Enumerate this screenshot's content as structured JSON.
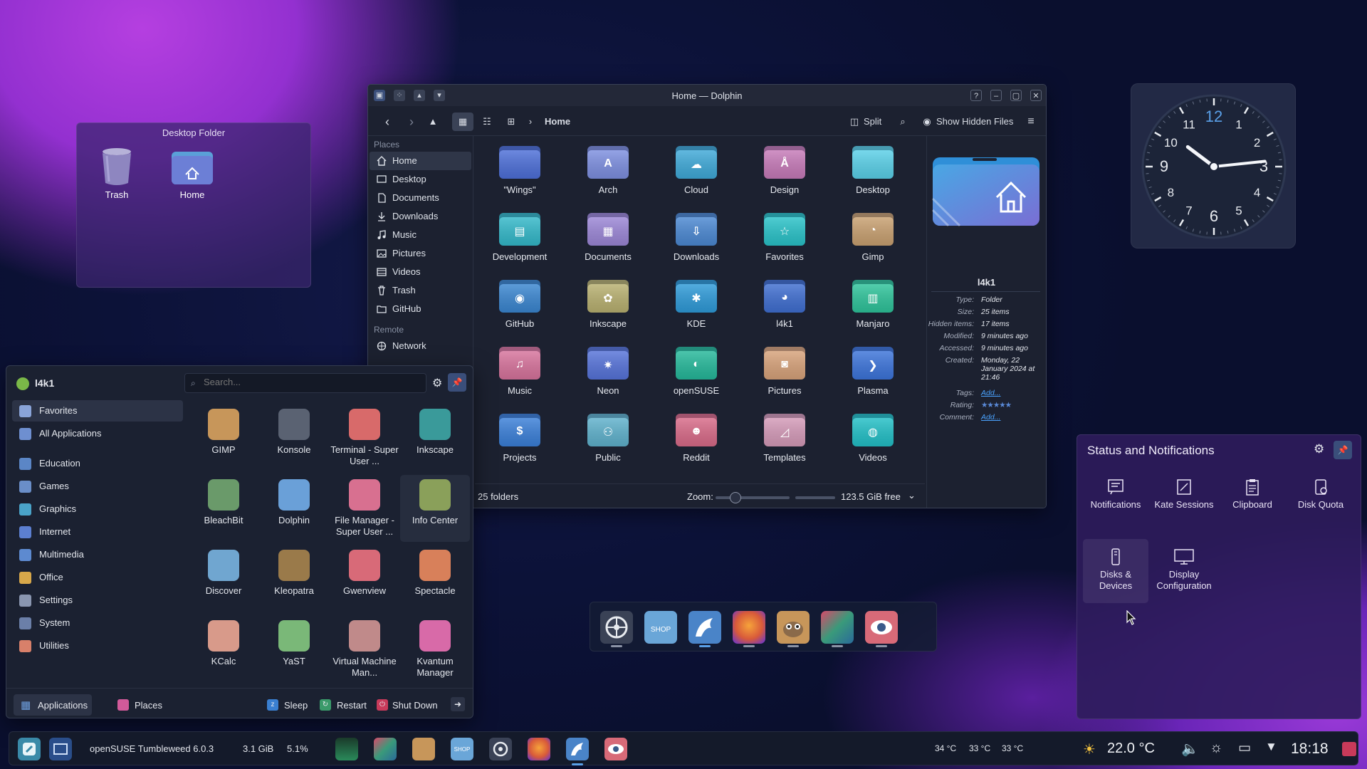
{
  "desktop_folder": {
    "title": "Desktop Folder",
    "items": [
      {
        "label": "Trash"
      },
      {
        "label": "Home"
      }
    ]
  },
  "dolphin": {
    "title": "Home — Dolphin",
    "breadcrumb": "Home",
    "toolbar": {
      "split": "Split",
      "show_hidden": "Show Hidden Files"
    },
    "places_header": "Places",
    "places": [
      {
        "label": "Home",
        "icon": "home-icon"
      },
      {
        "label": "Desktop",
        "icon": "desktop-icon"
      },
      {
        "label": "Documents",
        "icon": "documents-icon"
      },
      {
        "label": "Downloads",
        "icon": "downloads-icon"
      },
      {
        "label": "Music",
        "icon": "music-icon"
      },
      {
        "label": "Pictures",
        "icon": "pictures-icon"
      },
      {
        "label": "Videos",
        "icon": "videos-icon"
      },
      {
        "label": "Trash",
        "icon": "trash-icon"
      },
      {
        "label": "GitHub",
        "icon": "folder-icon"
      }
    ],
    "remote_header": "Remote",
    "remote": [
      {
        "label": "Network",
        "icon": "network-icon"
      }
    ],
    "folders": [
      {
        "label": "\"Wings\"",
        "color": "#4d6fd8",
        "glyph": ""
      },
      {
        "label": "Arch",
        "color": "#7d8fe0",
        "glyph": "A"
      },
      {
        "label": "Cloud",
        "color": "#3fa9d8",
        "glyph": "☁"
      },
      {
        "label": "Design",
        "color": "#c67ab8",
        "glyph": "Å"
      },
      {
        "label": "Desktop",
        "color": "#5ad0e8",
        "glyph": ""
      },
      {
        "label": "Development",
        "color": "#33b8c9",
        "glyph": "▤"
      },
      {
        "label": "Documents",
        "color": "#9b86d6",
        "glyph": "▦"
      },
      {
        "label": "Downloads",
        "color": "#4b88d2",
        "glyph": "⇩"
      },
      {
        "label": "Favorites",
        "color": "#29c2c8",
        "glyph": "☆"
      },
      {
        "label": "Gimp",
        "color": "#c8a070",
        "glyph": "◔"
      },
      {
        "label": "GitHub",
        "color": "#3a86d0",
        "glyph": "◉"
      },
      {
        "label": "Inkscape",
        "color": "#b8b070",
        "glyph": "✿"
      },
      {
        "label": "KDE",
        "color": "#2e9ad8",
        "glyph": "✱"
      },
      {
        "label": "l4k1",
        "color": "#3f6ed0",
        "glyph": "◕"
      },
      {
        "label": "Manjaro",
        "color": "#2ec39a",
        "glyph": "▥"
      },
      {
        "label": "Music",
        "color": "#d7739c",
        "glyph": "♫"
      },
      {
        "label": "Neon",
        "color": "#5673d9",
        "glyph": "✷"
      },
      {
        "label": "openSUSE",
        "color": "#25b89a",
        "glyph": "◐"
      },
      {
        "label": "Pictures",
        "color": "#d7a27a",
        "glyph": "◙"
      },
      {
        "label": "Plasma",
        "color": "#3c74da",
        "glyph": "❯"
      },
      {
        "label": "Projects",
        "color": "#3a7fd8",
        "glyph": "$"
      },
      {
        "label": "Public",
        "color": "#5fb1cc",
        "glyph": "⚇"
      },
      {
        "label": "Reddit",
        "color": "#d86a88",
        "glyph": "☻"
      },
      {
        "label": "Templates",
        "color": "#d49ab8",
        "glyph": "◿"
      },
      {
        "label": "Videos",
        "color": "#22bfc6",
        "glyph": "◍"
      }
    ],
    "info": {
      "name": "l4k1",
      "rows": [
        {
          "k": "Type:",
          "v": "Folder"
        },
        {
          "k": "Size:",
          "v": "25 items"
        },
        {
          "k": "Hidden items:",
          "v": "17 items"
        },
        {
          "k": "Modified:",
          "v": "9 minutes ago"
        },
        {
          "k": "Accessed:",
          "v": "9 minutes ago"
        },
        {
          "k": "Created:",
          "v": "Monday, 22 January 2024 at 21:46"
        }
      ],
      "tags_label": "Tags:",
      "tags_value": "Add...",
      "rating_label": "Rating:",
      "comment_label": "Comment:",
      "comment_value": "Add..."
    },
    "status": {
      "count": "25 folders",
      "zoom_label": "Zoom:",
      "free": "123.5 GiB free"
    }
  },
  "clock": {
    "hours": "10",
    "minutes": "14"
  },
  "app_menu": {
    "user": "l4k1",
    "search_placeholder": "Search...",
    "categories": [
      {
        "label": "Favorites",
        "color": "#8aa4d8"
      },
      {
        "label": "All Applications",
        "color": "#6e8fd0"
      },
      {
        "label": "Education",
        "color": "#5b86c6"
      },
      {
        "label": "Games",
        "color": "#6a8ec8"
      },
      {
        "label": "Graphics",
        "color": "#4aa3c8"
      },
      {
        "label": "Internet",
        "color": "#5c7fd0"
      },
      {
        "label": "Multimedia",
        "color": "#5d8ad0"
      },
      {
        "label": "Office",
        "color": "#d8a84a"
      },
      {
        "label": "Settings",
        "color": "#8a96b0"
      },
      {
        "label": "System",
        "color": "#6b7fa8"
      },
      {
        "label": "Utilities",
        "color": "#d8806a"
      }
    ],
    "apps": [
      {
        "label": "GIMP",
        "color": "#c7965a"
      },
      {
        "label": "Konsole",
        "color": "#5a6272"
      },
      {
        "label": "Terminal - Super User ...",
        "color": "#d86a6a"
      },
      {
        "label": "Inkscape",
        "color": "#3a9a9a"
      },
      {
        "label": "BleachBit",
        "color": "#6a9a6a"
      },
      {
        "label": "Dolphin",
        "color": "#6aa0d8"
      },
      {
        "label": "File Manager - Super User ...",
        "color": "#d87090"
      },
      {
        "label": "Info Center",
        "color": "#8aa05a"
      },
      {
        "label": "Discover",
        "color": "#70a6d0"
      },
      {
        "label": "Kleopatra",
        "color": "#9a7a4a"
      },
      {
        "label": "Gwenview",
        "color": "#d86a78"
      },
      {
        "label": "Spectacle",
        "color": "#d8805a"
      },
      {
        "label": "KCalc",
        "color": "#d89a8a"
      },
      {
        "label": "YaST",
        "color": "#7ab878"
      },
      {
        "label": "Virtual Machine Man...",
        "color": "#c08a8a"
      },
      {
        "label": "Kvantum Manager",
        "color": "#d86aa8"
      }
    ],
    "footer": {
      "applications": "Applications",
      "places": "Places",
      "sleep": "Sleep",
      "restart": "Restart",
      "shutdown": "Shut Down"
    }
  },
  "status_panel": {
    "title": "Status and Notifications",
    "items": [
      {
        "label": "Notifications"
      },
      {
        "label": "Kate Sessions"
      },
      {
        "label": "Clipboard"
      },
      {
        "label": "Disk Quota"
      },
      {
        "label": "Disks & Devices"
      },
      {
        "label": "Display Configuration"
      }
    ]
  },
  "taskbar": {
    "distro": "openSUSE Tumbleweed 6.0.3",
    "mem": "3.1 GiB",
    "cpu": "5.1%",
    "temps": [
      "34 °C",
      "33 °C",
      "33 °C"
    ],
    "weather": "22.0 °C",
    "time": "18:18"
  }
}
